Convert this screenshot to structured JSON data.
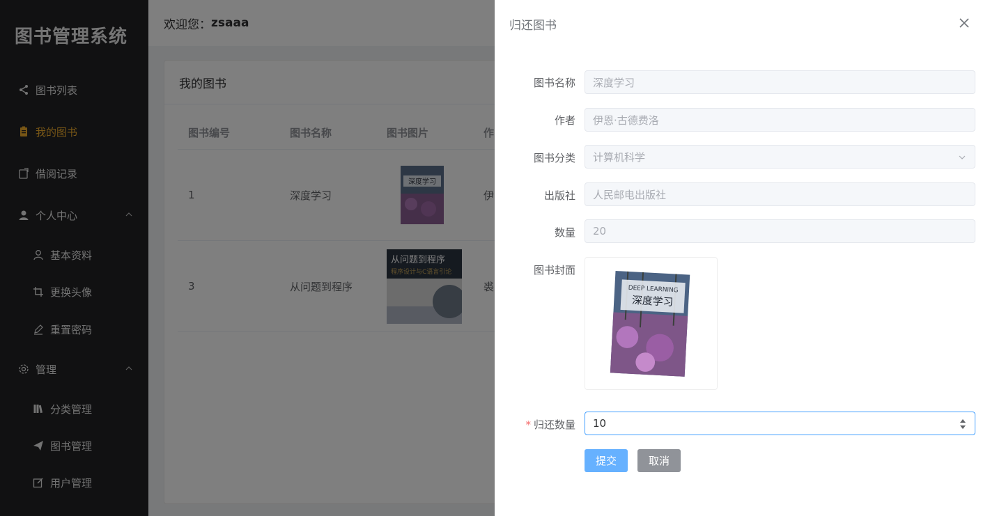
{
  "app": {
    "title": "图书管理系统"
  },
  "sidebar": {
    "items": [
      {
        "label": "图书列表",
        "icon": "share-icon"
      },
      {
        "label": "我的图书",
        "icon": "clipboard-icon"
      },
      {
        "label": "借阅记录",
        "icon": "notebook-icon"
      },
      {
        "label": "个人中心",
        "icon": "user-icon"
      },
      {
        "label": "基本资料",
        "icon": "user-outline-icon"
      },
      {
        "label": "更换头像",
        "icon": "crop-icon"
      },
      {
        "label": "重置密码",
        "icon": "edit-pen-icon"
      },
      {
        "label": "管理",
        "icon": "gear-icon"
      },
      {
        "label": "分类管理",
        "icon": "books-icon"
      },
      {
        "label": "图书管理",
        "icon": "send-icon"
      },
      {
        "label": "用户管理",
        "icon": "edit-icon"
      }
    ],
    "active_color": "#f0ad2d"
  },
  "header": {
    "welcome": "欢迎您：",
    "username": "zsaaa"
  },
  "card": {
    "title": "我的图书",
    "columns": [
      "图书编号",
      "图书名称",
      "图书图片",
      "作"
    ],
    "rows": [
      {
        "id": "1",
        "name": "深度学习",
        "author_partial": "伊"
      },
      {
        "id": "3",
        "name": "从问题到程序",
        "author_partial": "裘"
      }
    ]
  },
  "drawer": {
    "title": "归还图书",
    "fields": {
      "name": {
        "label": "图书名称",
        "value": "深度学习"
      },
      "author": {
        "label": "作者",
        "value": "伊恩·古德费洛"
      },
      "category": {
        "label": "图书分类",
        "value": "计算机科学"
      },
      "publisher": {
        "label": "出版社",
        "value": "人民邮电出版社"
      },
      "quantity": {
        "label": "数量",
        "value": "20"
      },
      "cover": {
        "label": "图书封面"
      },
      "return_quantity": {
        "label": "归还数量",
        "value": "10",
        "required_mark": "*"
      }
    },
    "buttons": {
      "submit": "提交",
      "cancel": "取消"
    }
  },
  "book1_cover": {
    "english": "DEEP LEARNING",
    "chinese": "深度学习"
  },
  "book2_cover": {
    "line1": "从问题到程序",
    "line2": "程序设计与C语言引论"
  }
}
